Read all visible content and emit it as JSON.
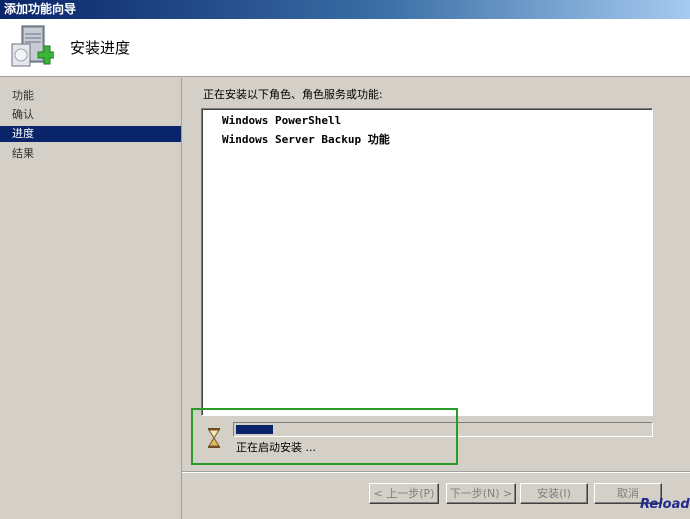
{
  "window": {
    "title": "添加功能向导"
  },
  "header": {
    "title": "安装进度",
    "icon": "server-add-icon"
  },
  "nav": {
    "items": [
      {
        "label": "功能",
        "active": false
      },
      {
        "label": "确认",
        "active": false
      },
      {
        "label": "进度",
        "active": true
      },
      {
        "label": "结果",
        "active": false
      }
    ]
  },
  "main": {
    "heading": "正在安装以下角色、角色服务或功能:",
    "features": [
      "Windows PowerShell",
      "Windows Server Backup 功能"
    ],
    "progress": {
      "value_percent": 9,
      "status": "正在启动安装 ..."
    },
    "status_icon": "hourglass-icon"
  },
  "buttons": {
    "prev": "< 上一步(P)",
    "next": "下一步(N) >",
    "install": "安装(I)",
    "cancel": "取消"
  },
  "overlay": {
    "reload_label": "Reload"
  },
  "colors": {
    "accent": "#0a246a",
    "highlight": "#2a9a2a",
    "reload": "#1f2b8f"
  }
}
